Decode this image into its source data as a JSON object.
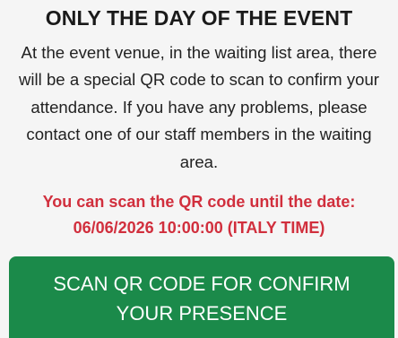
{
  "heading": "ONLY THE DAY OF THE EVENT",
  "instructions": "At the event venue, in the waiting list area, there will be a special QR code to scan to confirm your attendance. If you have any problems, please contact one of our staff members in the waiting area.",
  "deadline": {
    "line1": "You can scan the QR code until the date:",
    "line2": "06/06/2026 10:00:00 (ITALY TIME)"
  },
  "scan_button": {
    "line1": "SCAN QR CODE FOR CONFIRM",
    "line2": "YOUR PRESENCE"
  },
  "colors": {
    "deadline_text": "#d12f3d",
    "button_background": "#1b8a4a"
  }
}
